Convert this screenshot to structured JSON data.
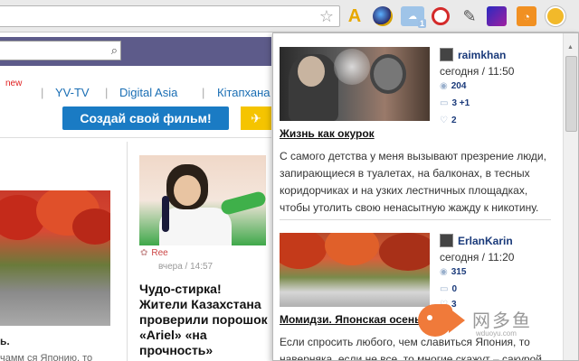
{
  "toolbar": {
    "ext_a_label": "A",
    "ext_c_badge": "1"
  },
  "page": {
    "nav_new": "new",
    "nav": [
      "YV-TV",
      "Digital Asia",
      "Кітапхана"
    ],
    "create_film_button": "Создай свой фильм!",
    "yellow_button_icon": "✈",
    "left_card": {
      "title": "ь.",
      "subtitle": "чамм ся Японию, то"
    },
    "mid_card": {
      "source": "Ree",
      "time": "вчера / 14:57",
      "title": "Чудо-стирка! Жители Казахстана проверили порошок «Ariel» «на прочность»"
    }
  },
  "popup": {
    "posts": [
      {
        "author": "raimkhan",
        "time": "сегодня / 11:50",
        "views": "204",
        "comments": "3 +1",
        "likes": "2",
        "title": "Жизнь как окурок",
        "text": "С самого детства у меня вызывают презрение люди, запирающиеся в туалетах, на балконах, в тесных коридорчиках и на узких лестничных площадках, чтобы утолить свою ненасытную жажду к никотину."
      },
      {
        "author": "ErlanKarin",
        "time": "сегодня / 11:20",
        "views": "315",
        "comments": "0",
        "likes": "3",
        "title": "Момидзи. Японская осень",
        "text": "Если спросить любого, чем славиться Япония, то наверняка, если не все, то многие скажут – сакурой,"
      }
    ]
  },
  "watermark": {
    "text": "网多鱼",
    "sub": "wduoyu.com"
  }
}
